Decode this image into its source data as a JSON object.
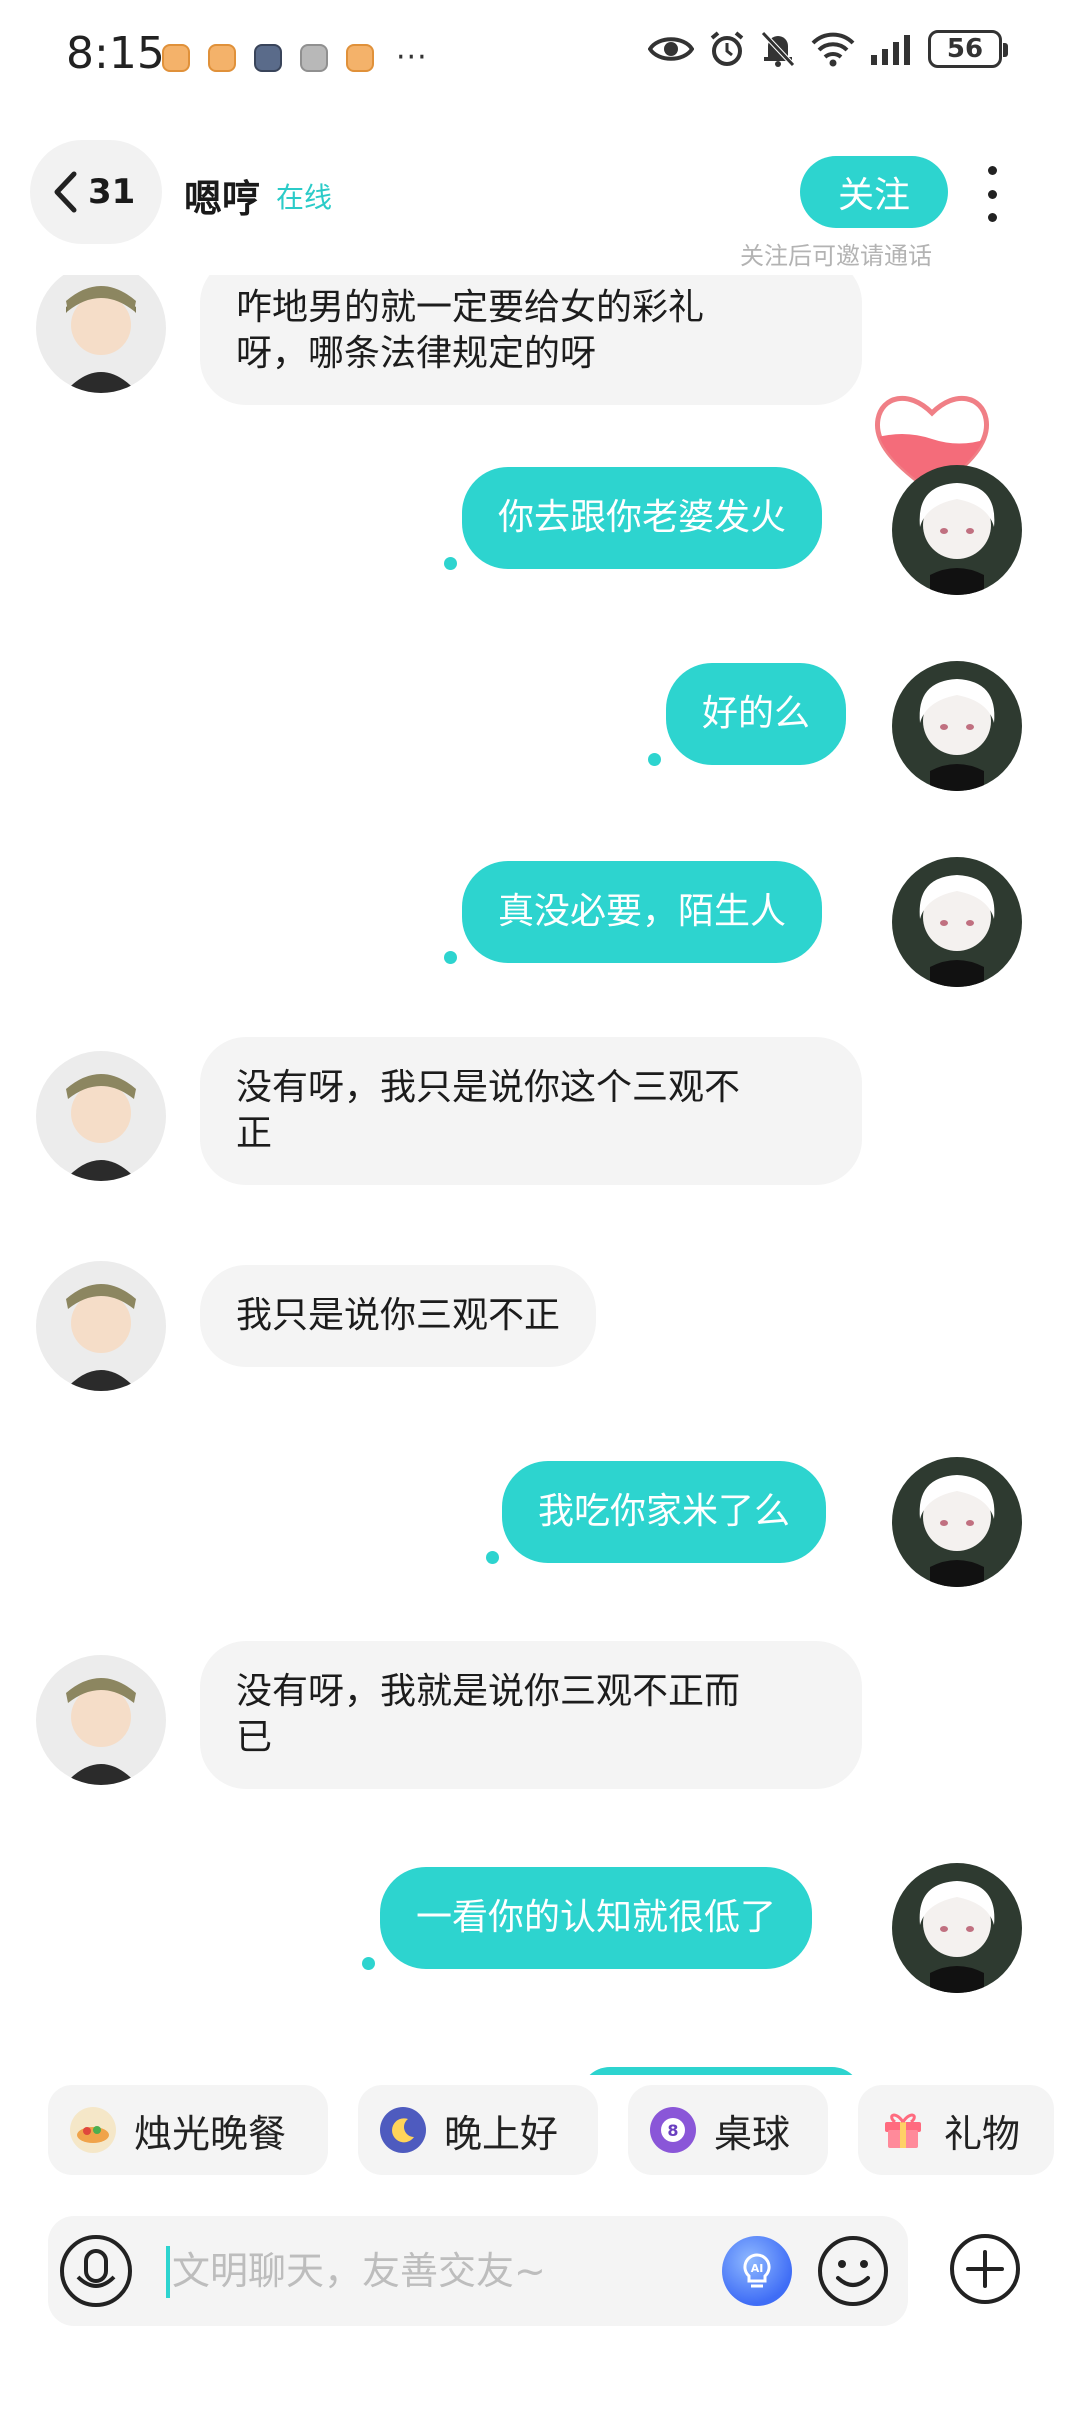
{
  "status_bar": {
    "time": "8:15",
    "more": "···",
    "battery": "56",
    "icons": [
      "eye-icon",
      "alarm-icon",
      "mute-bell-icon",
      "wifi-6-icon",
      "signal-icon",
      "battery-icon"
    ]
  },
  "header": {
    "back_count": "31",
    "name": "嗯哼",
    "status": "在线",
    "follow_label": "关注",
    "follow_hint": "关注后可邀请通话"
  },
  "messages": [
    {
      "side": "in",
      "text": "咋地男的就一定要给女的彩礼\n呀，哪条法律规定的呀"
    },
    {
      "side": "out",
      "text": "你去跟你老婆发火"
    },
    {
      "side": "out",
      "text": "好的么"
    },
    {
      "side": "out",
      "text": "真没必要，陌生人"
    },
    {
      "side": "in",
      "text": "没有呀，我只是说你这个三观不\n正"
    },
    {
      "side": "in",
      "text": "我只是说你三观不正"
    },
    {
      "side": "out",
      "text": "我吃你家米了么"
    },
    {
      "side": "in",
      "text": "没有呀，我就是说你三观不正而\n已"
    },
    {
      "side": "out",
      "text": "一看你的认知就很低了"
    }
  ],
  "quick_actions": [
    {
      "label": "烛光晚餐",
      "icon": "candle-dinner-icon"
    },
    {
      "label": "晚上好",
      "icon": "moon-icon"
    },
    {
      "label": "桌球",
      "icon": "billiard-ball-icon"
    },
    {
      "label": "礼物",
      "icon": "gift-icon"
    }
  ],
  "input": {
    "placeholder": "文明聊天，友善交友~",
    "value": ""
  },
  "colors": {
    "accent": "#2dd4cf",
    "bubble_in": "#f4f4f4",
    "bubble_out": "#2dd4cf"
  }
}
